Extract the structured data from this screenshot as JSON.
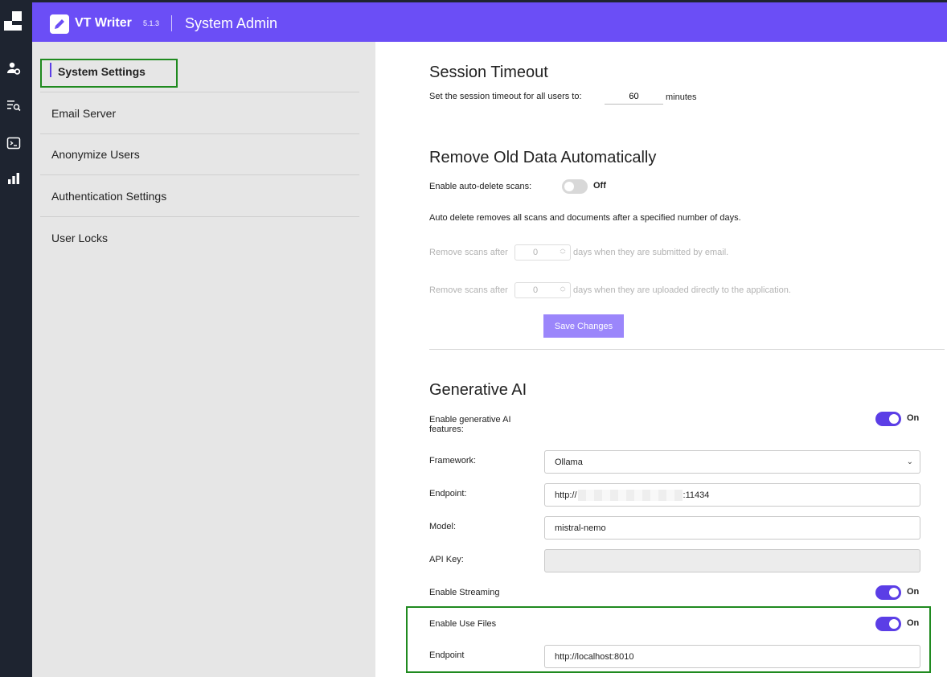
{
  "header": {
    "app_name": "VT Writer",
    "version": "5.1.3",
    "page_title": "System Admin",
    "accent": "#6b4ef6"
  },
  "rail": {
    "icons": [
      "user-settings-icon",
      "list-search-icon",
      "terminal-icon",
      "bar-chart-icon"
    ]
  },
  "nav": {
    "items": [
      {
        "label": "System Settings",
        "active": true
      },
      {
        "label": "Email Server"
      },
      {
        "label": "Anonymize Users"
      },
      {
        "label": "Authentication Settings"
      },
      {
        "label": "User Locks"
      }
    ]
  },
  "session": {
    "title": "Session Timeout",
    "label": "Set the session timeout for all users to:",
    "value": "60",
    "unit": "minutes"
  },
  "remove_old": {
    "title": "Remove Old Data Automatically",
    "enable_label": "Enable auto-delete scans:",
    "toggle_state": "Off",
    "description": "Auto delete removes all scans and documents after a specified number of days.",
    "email_prefix": "Remove scans after",
    "email_value": "0",
    "email_suffix": "days when they are submitted by email.",
    "upload_prefix": "Remove scans after",
    "upload_value": "0",
    "upload_suffix": "days when they are uploaded directly to the application.",
    "save_label": "Save Changes"
  },
  "gen_ai": {
    "title": "Generative AI",
    "enable_label": "Enable generative AI features:",
    "enable_state": "On",
    "framework_label": "Framework:",
    "framework_value": "Ollama",
    "endpoint_label": "Endpoint:",
    "endpoint_prefix": "http://",
    "endpoint_suffix": ":11434",
    "model_label": "Model:",
    "model_value": "mistral-nemo",
    "api_key_label": "API Key:",
    "api_key_value": "",
    "streaming_label": "Enable Streaming",
    "streaming_state": "On",
    "use_files_label": "Enable Use Files",
    "use_files_state": "On",
    "files_endpoint_label": "Endpoint",
    "files_endpoint_value": "http://localhost:8010"
  }
}
